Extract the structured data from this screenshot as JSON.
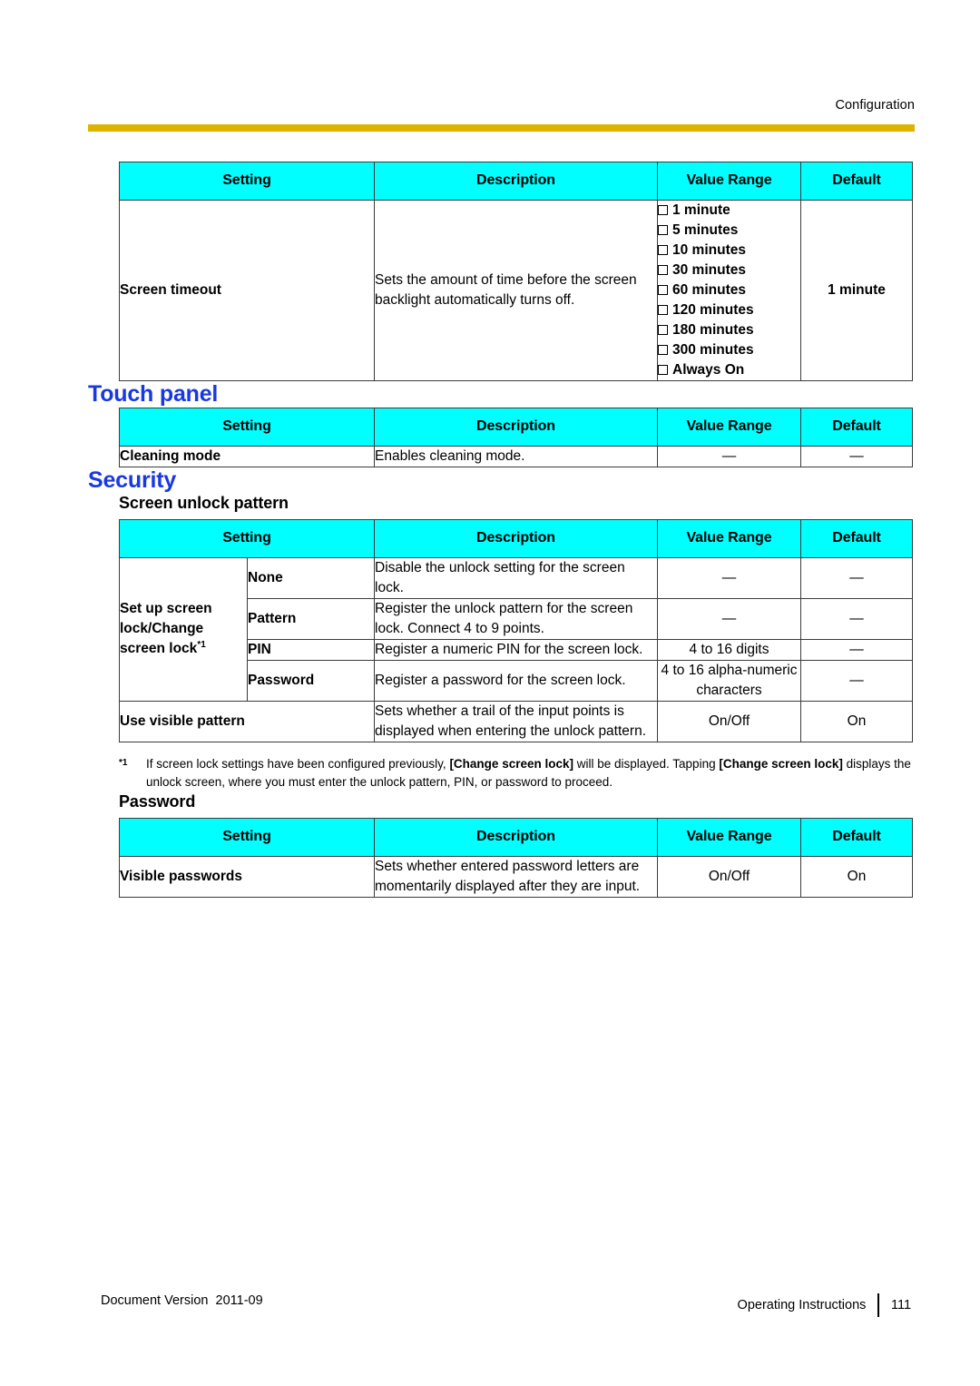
{
  "header": {
    "running_head": "Configuration",
    "rule_color": "#dcb400"
  },
  "theme": {
    "heading_color": "#1939e0",
    "table_header_bg": "#00ffff",
    "border_color": "#3b3b3b"
  },
  "columns": {
    "setting": "Setting",
    "description": "Description",
    "value_range": "Value Range",
    "default": "Default"
  },
  "screen_timeout_table": {
    "row": {
      "setting": "Screen timeout",
      "description": "Sets the amount of time before the screen backlight automatically turns off.",
      "value_range_options": [
        "1 minute",
        "5 minutes",
        "10 minutes",
        "30 minutes",
        "60 minutes",
        "120 minutes",
        "180 minutes",
        "300 minutes",
        "Always On"
      ],
      "default": "1 minute"
    }
  },
  "touch_panel": {
    "heading": "Touch panel",
    "rows": [
      {
        "setting": "Cleaning mode",
        "description": "Enables cleaning mode.",
        "value_range": "—",
        "default": "—"
      }
    ]
  },
  "security": {
    "heading": "Security",
    "screen_unlock_pattern": {
      "sub_heading": "Screen unlock pattern",
      "group_label": "Set up screen lock/Change screen lock",
      "group_label_footnote": "*1",
      "group_rows": [
        {
          "name": "None",
          "description": "Disable the unlock setting for the screen lock.",
          "value_range": "—",
          "default": "—"
        },
        {
          "name": "Pattern",
          "description": "Register the unlock pattern for the screen lock. Connect 4 to 9 points.",
          "value_range": "—",
          "default": "—"
        },
        {
          "name": "PIN",
          "description": "Register a numeric PIN for the screen lock.",
          "value_range": "4 to 16 digits",
          "default": "—"
        },
        {
          "name": "Password",
          "description": "Register a password for the screen lock.",
          "value_range": "4 to 16 alpha-numeric characters",
          "default": "—"
        }
      ],
      "standalone_row": {
        "setting": "Use visible pattern",
        "description": "Sets whether a trail of the input points is displayed when entering the unlock pattern.",
        "value_range": "On/Off",
        "default": "On"
      },
      "footnote": {
        "marker": "*1",
        "part1": "If screen lock settings have been configured previously, ",
        "bold1": "[Change screen lock]",
        "part2": " will be displayed. Tapping ",
        "bold2": "[Change screen lock]",
        "part3": " displays the unlock screen, where you must enter the unlock pattern, PIN, or password to proceed."
      }
    },
    "password": {
      "sub_heading": "Password",
      "rows": [
        {
          "setting": "Visible passwords",
          "description": "Sets whether entered password letters are momentarily displayed after they are input.",
          "value_range": "On/Off",
          "default": "On"
        }
      ]
    }
  },
  "footer": {
    "document_version": "Document Version  2011-09",
    "manual_name": "Operating Instructions",
    "page_number": "111"
  }
}
